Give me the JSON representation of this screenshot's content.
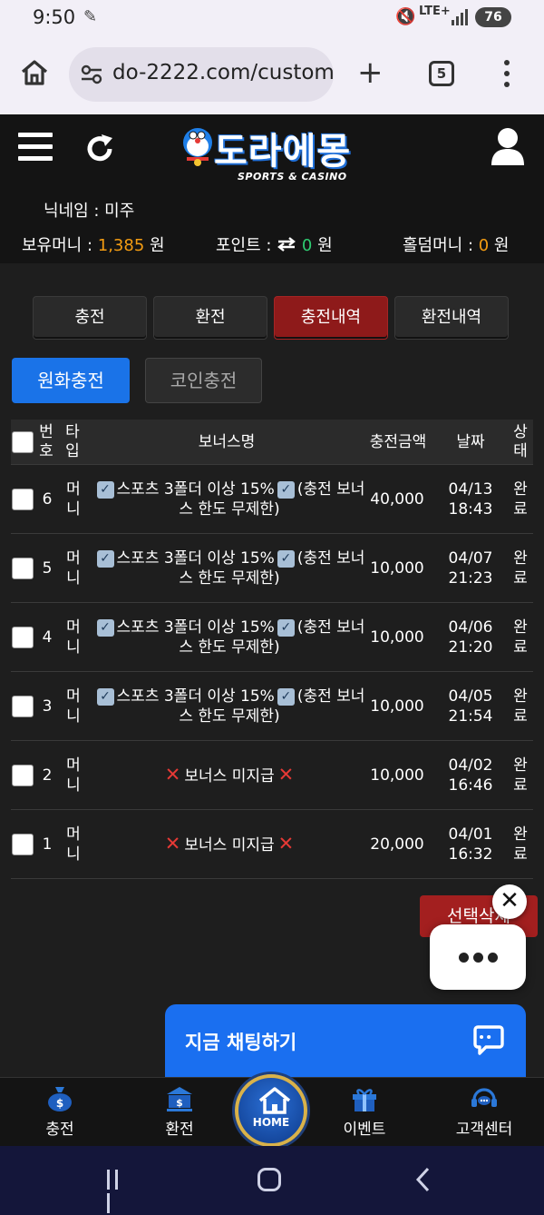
{
  "status_bar": {
    "time": "9:50",
    "network": "LTE+",
    "battery": "76"
  },
  "browser": {
    "url": "do-2222.com/custom",
    "tab_count": "5"
  },
  "site": {
    "brand": "도라에몽",
    "brand_sub": "SPORTS & CASINO",
    "nickname_label": "닉네임 : 미주",
    "balance_label": "보유머니 : ",
    "balance_value": "1,385",
    "balance_unit": " 원",
    "point_label": "포인트 : ",
    "point_value": "0",
    "point_unit": " 원",
    "holdem_label": "홀덤머니 : ",
    "holdem_value": "0",
    "holdem_unit": " 원"
  },
  "tabs": [
    {
      "label": "충전",
      "active": false
    },
    {
      "label": "환전",
      "active": false
    },
    {
      "label": "충전내역",
      "active": true
    },
    {
      "label": "환전내역",
      "active": false
    }
  ],
  "subtabs": {
    "won": "원화충전",
    "coin": "코인충전"
  },
  "table": {
    "headers": {
      "no": "번호",
      "type": "타입",
      "bonus": "보너스명",
      "amount": "충전금액",
      "date": "날짜",
      "status": "상태"
    },
    "rows": [
      {
        "no": "6",
        "type": "머니",
        "bonus_kind": "check",
        "bonus_a": "스포츠 3폴더 이상 15%",
        "bonus_b": "(충전 보너스 한도 무제한)",
        "amount": "40,000",
        "date": "04/13",
        "time": "18:43",
        "status": "완료"
      },
      {
        "no": "5",
        "type": "머니",
        "bonus_kind": "check",
        "bonus_a": "스포츠 3폴더 이상 15%",
        "bonus_b": "(충전 보너스 한도 무제한)",
        "amount": "10,000",
        "date": "04/07",
        "time": "21:23",
        "status": "완료"
      },
      {
        "no": "4",
        "type": "머니",
        "bonus_kind": "check",
        "bonus_a": "스포츠 3폴더 이상 15%",
        "bonus_b": "(충전 보너스 한도 무제한)",
        "amount": "10,000",
        "date": "04/06",
        "time": "21:20",
        "status": "완료"
      },
      {
        "no": "3",
        "type": "머니",
        "bonus_kind": "check",
        "bonus_a": "스포츠 3폴더 이상 15%",
        "bonus_b": "(충전 보너스 한도 무제한)",
        "amount": "10,000",
        "date": "04/05",
        "time": "21:54",
        "status": "완료"
      },
      {
        "no": "2",
        "type": "머니",
        "bonus_kind": "none",
        "bonus_a": "보너스 미지급",
        "bonus_b": "",
        "amount": "10,000",
        "date": "04/02",
        "time": "16:46",
        "status": "완료"
      },
      {
        "no": "1",
        "type": "머니",
        "bonus_kind": "none",
        "bonus_a": "보너스 미지급",
        "bonus_b": "",
        "amount": "20,000",
        "date": "04/01",
        "time": "16:32",
        "status": "완료"
      }
    ]
  },
  "delete_button": "선택삭제",
  "chat_label": "지금 채팅하기",
  "bottom_nav": {
    "deposit": "충전",
    "withdraw": "환전",
    "home": "HOME",
    "event": "이벤트",
    "support": "고객센터"
  },
  "icons": {
    "browser_home": "home-icon",
    "site_settings": "tune-icon",
    "new_tab": "plus-icon",
    "tabs": "tab-switcher-icon",
    "menu": "more-vert-icon",
    "refresh": "refresh-icon",
    "user": "user-icon",
    "transfer": "swap-arrows-icon",
    "check_emoji": "check-box-emoji",
    "cross_emoji": "cross-mark-emoji",
    "chat": "chat-bubble-icon"
  },
  "colors": {
    "accent_blue": "#1a73e8",
    "active_tab_red": "#8e1a1a",
    "money_orange": "#f39c12",
    "point_green": "#2ecc71",
    "delete_red": "#a31f1f"
  }
}
